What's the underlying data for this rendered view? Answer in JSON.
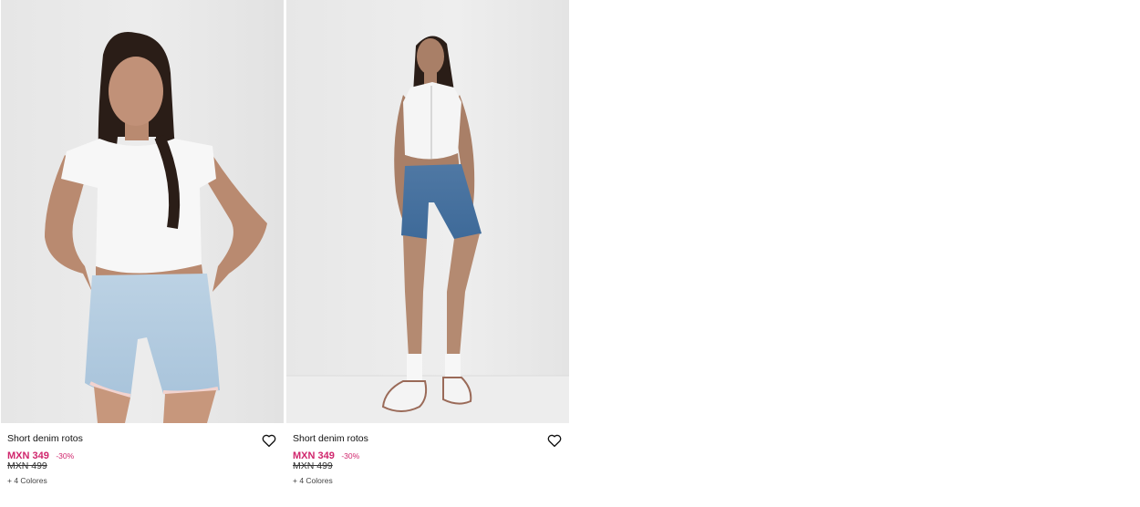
{
  "products": [
    {
      "image_alt": "Short denim rotos claro",
      "name": "Short denim rotos",
      "price": "MXN 349",
      "discount": "-30%",
      "old_price": "MXN 499",
      "colors": "+ 4 Colores",
      "favorite_icon": "heart-outline-icon"
    },
    {
      "image_alt": "Short denim rotos medio",
      "name": "Short denim rotos",
      "price": "MXN 349",
      "discount": "-30%",
      "old_price": "MXN 499",
      "colors": "+ 4 Colores",
      "favorite_icon": "heart-outline-icon"
    }
  ],
  "colors": {
    "sale": "#d0256c",
    "text": "#111111",
    "background": "#ffffff",
    "photo_background": "#e8e8e8"
  }
}
